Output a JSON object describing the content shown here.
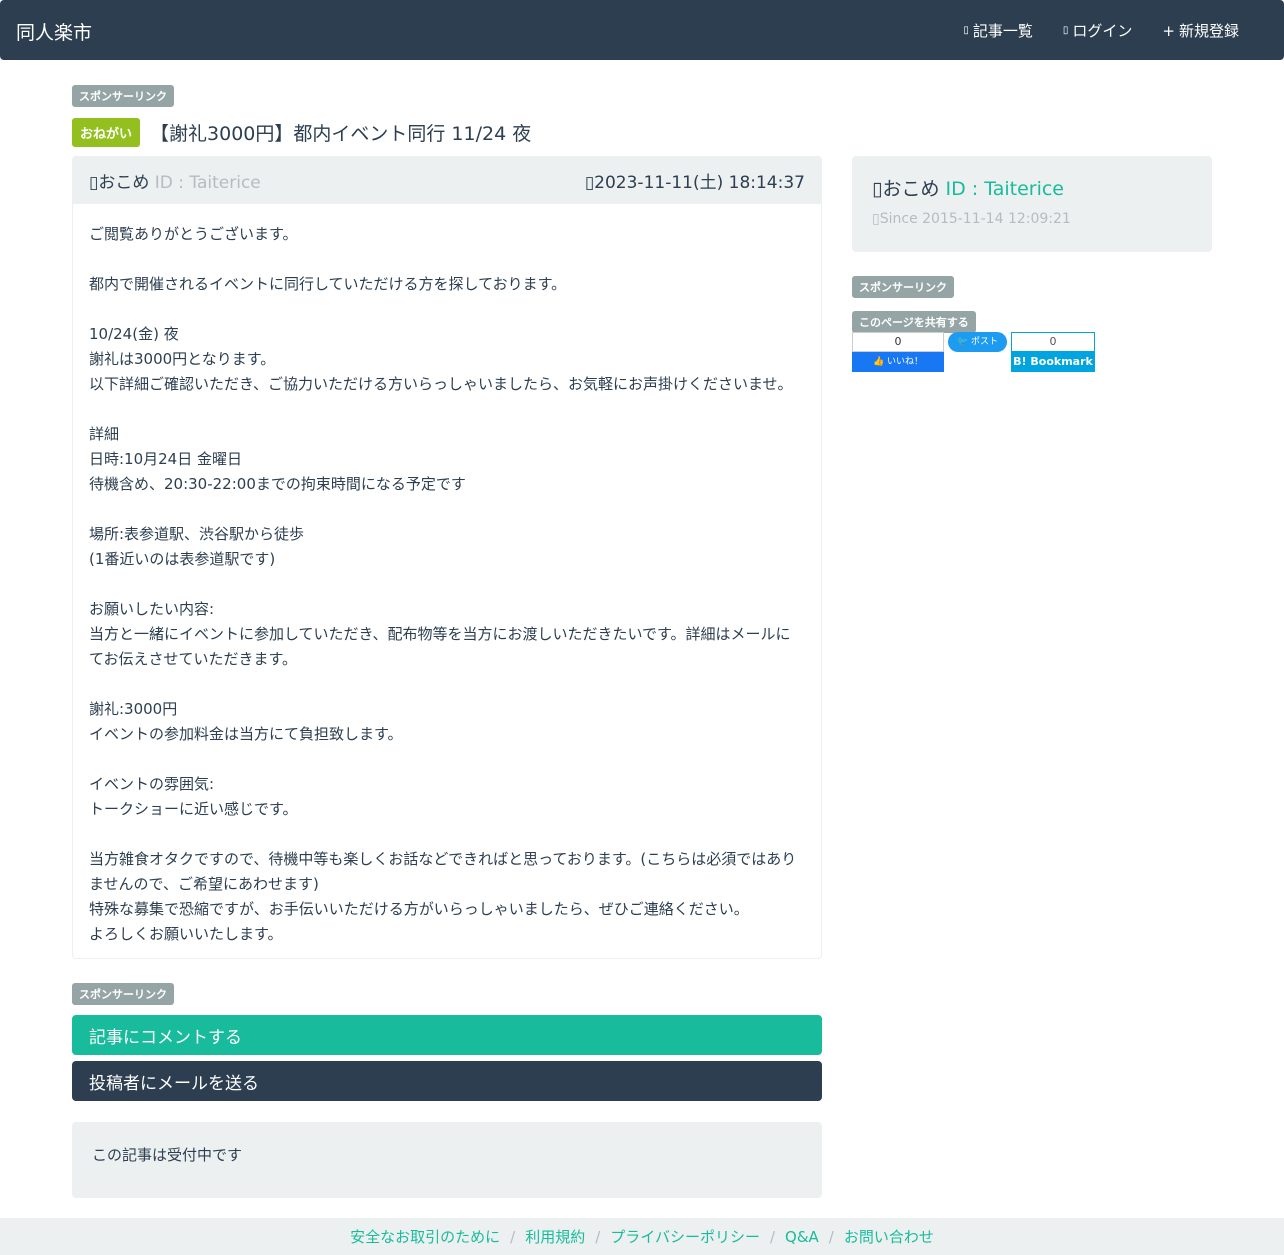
{
  "nav": {
    "brand": "同人楽市",
    "links": [
      {
        "icon": "list-icon",
        "glyph": "▯",
        "label": "記事一覧"
      },
      {
        "icon": "login-icon",
        "glyph": "▯",
        "label": "ログイン"
      },
      {
        "icon": "plus-icon",
        "glyph": "+",
        "label": "新規登録"
      }
    ]
  },
  "sponsor_label": "スポンサーリンク",
  "post": {
    "badge": "おねがい",
    "title": "【謝礼3000円】都内イベント同行 11/24 夜",
    "author_icon": "▯",
    "author": "おこめ",
    "author_id": "ID : Taiterice",
    "date_icon": "▯",
    "date": "2023-11-11(土) 18:14:37",
    "body": [
      "ご閲覧ありがとうございます。",
      "",
      "都内で開催されるイベントに同行していただける方を探しております。",
      "",
      "10/24(金) 夜",
      "謝礼は3000円となります。",
      "以下詳細ご確認いただき、ご協力いただける方いらっしゃいましたら、お気軽にお声掛けくださいませ。",
      "",
      "詳細",
      "日時:10月24日 金曜日",
      "待機含め、20:30-22:00までの拘束時間になる予定です",
      "",
      "場所:表参道駅、渋谷駅から徒歩",
      "(1番近いのは表参道駅です)",
      "",
      "お願いしたい内容:",
      "当方と一緒にイベントに参加していただき、配布物等を当方にお渡しいただきたいです。詳細はメールにてお伝えさせていただきます。",
      "",
      "謝礼:3000円",
      "イベントの参加料金は当方にて負担致します。",
      "",
      "イベントの雰囲気:",
      "トークショーに近い感じです。",
      "",
      "当方雑食オタクですので、待機中等も楽しくお話などできればと思っております。(こちらは必須ではありませんので、ご希望にあわせます)",
      "特殊な募集で恐縮ですが、お手伝いいただける方がいらっしゃいましたら、ぜひご連絡ください。",
      "よろしくお願いいたします。"
    ]
  },
  "actions": {
    "comment": "記事にコメントする",
    "mail": "投稿者にメールを送る"
  },
  "status": "この記事は受付中です",
  "sidebar": {
    "user_icon": "▯",
    "user_name": "おこめ",
    "user_id": "ID : Taiterice",
    "since_icon": "▯",
    "since": "Since 2015-11-14 12:09:21",
    "share_label": "このページを共有する",
    "fb_count": "0",
    "fb_button": "いいね！",
    "tw_button": "ポスト",
    "hb_count": "0",
    "hb_button": "B! Bookmark"
  },
  "footer": {
    "links": [
      "安全なお取引のために",
      "利用規約",
      "プライバシーポリシー",
      "Q&A",
      "お問い合わせ"
    ],
    "separator": "/"
  },
  "colors": {
    "navbar": "#2c3e50",
    "accent": "#18bc9c",
    "badge": "#93c01f",
    "muted": "#95a5a6"
  }
}
